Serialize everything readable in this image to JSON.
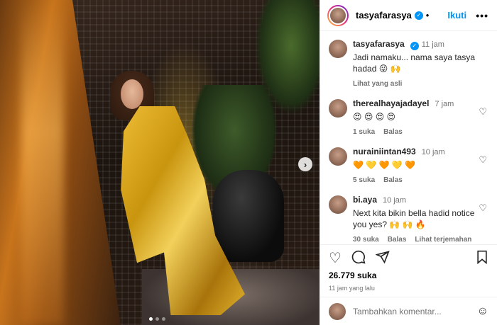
{
  "header": {
    "username": "tasyafarasya",
    "separator": "•",
    "follow_label": "Ikuti",
    "more_label": "•••"
  },
  "caption": {
    "username": "tasyafarasya",
    "time": "11 jam",
    "text": "Jadi namaku... nama saya tasya hadad 😜 🙌",
    "see_original": "Lihat yang asli"
  },
  "comments": [
    {
      "username": "therealhayajadayel",
      "time": "7 jam",
      "text": "😍 😍 😍 😍",
      "likes": "1 suka",
      "reply": "Balas",
      "translate": ""
    },
    {
      "username": "nurainiintan493",
      "time": "10 jam",
      "text": "🧡 💛 🧡 💛 🧡",
      "likes": "5 suka",
      "reply": "Balas",
      "translate": ""
    },
    {
      "username": "bi.aya",
      "time": "10 jam",
      "text": "Next kita bikin bella hadid notice you yes? 🙌 🙌 🔥",
      "likes": "30 suka",
      "reply": "Balas",
      "translate": "Lihat terjemahan"
    }
  ],
  "actions": {
    "likes": "26.779 suka",
    "posted": "11 jam yang lalu"
  },
  "composer": {
    "placeholder": "Tambahkan komentar..."
  },
  "icons": {
    "heart": "heart-icon",
    "comment": "comment-icon",
    "share": "share-icon",
    "bookmark": "bookmark-icon",
    "emoji": "emoji-icon",
    "next": "chevron-right-icon"
  }
}
